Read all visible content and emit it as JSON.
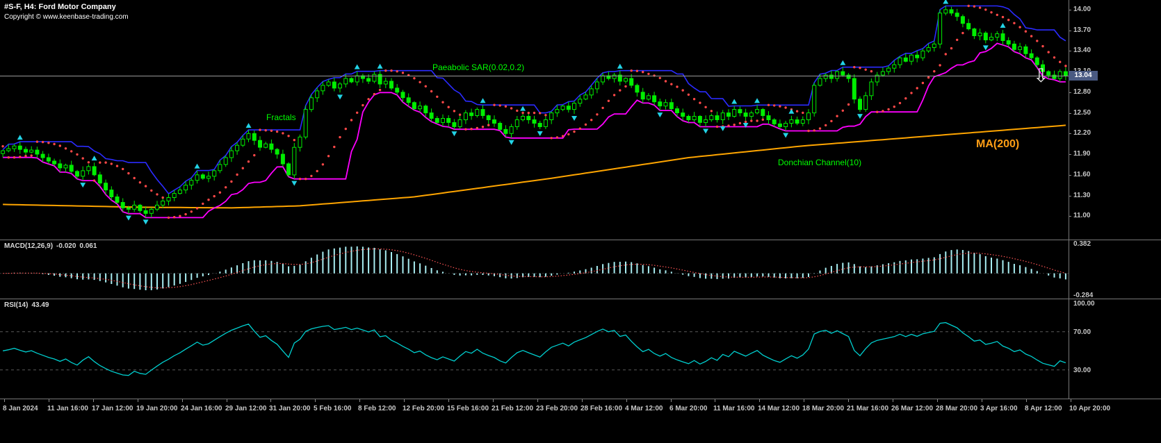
{
  "window": {
    "symbol_info": "#S-F, H4:  Ford Motor Company",
    "copyright": "Copyright © www.keenbase-trading.com"
  },
  "overlays": {
    "psar_label": "Paeabolic SAR(0.02,0.2)",
    "fractals_label": "Fractals",
    "donchian_label": "Donchian Channel(10)",
    "ma_label": "MA(200)"
  },
  "icons": {
    "down_arrow": "⇩"
  },
  "price_axis": {
    "labels": [
      "14.00",
      "13.70",
      "13.40",
      "13.10",
      "12.80",
      "12.50",
      "12.20",
      "11.90",
      "11.60",
      "11.30",
      "11.00"
    ],
    "current_price": "13.04"
  },
  "macd_panel": {
    "label": "MACD(12,26,9)",
    "value_main": "-0.020",
    "value_signal": "0.061",
    "axis_labels": [
      "0.382",
      "-0.284"
    ]
  },
  "rsi_panel": {
    "label": "RSI(14)",
    "value": "43.49",
    "axis_labels": [
      "100.00",
      "70.00",
      "30.00"
    ],
    "levels": [
      70,
      30
    ]
  },
  "time_axis": [
    "8 Jan 2024",
    "11 Jan 16:00",
    "17 Jan 12:00",
    "19 Jan 20:00",
    "24 Jan 16:00",
    "29 Jan 12:00",
    "31 Jan 20:00",
    "5 Feb 16:00",
    "8 Feb 12:00",
    "12 Feb 20:00",
    "15 Feb 16:00",
    "21 Feb 12:00",
    "23 Feb 20:00",
    "28 Feb 16:00",
    "4 Mar 12:00",
    "6 Mar 20:00",
    "11 Mar 16:00",
    "14 Mar 12:00",
    "18 Mar 20:00",
    "21 Mar 16:00",
    "26 Mar 12:00",
    "28 Mar 20:00",
    "3 Apr 16:00",
    "8 Apr 12:00",
    "10 Apr 20:00"
  ],
  "colors": {
    "background": "#000000",
    "candle": "#00ee00",
    "donchian_upper": "#2b2bff",
    "donchian_lower": "#ff00ff",
    "psar": "#ff4848",
    "ma200": "#ffa500",
    "fractal": "#22d3e6",
    "macd_hist": "#a9eef2",
    "macd_signal": "#ff5555",
    "rsi_line": "#00cfcf",
    "axis_text": "#c6c6c6",
    "label_green": "#00ff00",
    "label_orange": "#ff9e15",
    "price_tag_bg": "#4a5a82",
    "separator": "#787878"
  },
  "chart_data": {
    "type": "candlestick",
    "symbol": "#S-F",
    "timeframe": "H4",
    "company": "Ford Motor Company",
    "title": "#S-F, H4: Ford Motor Company",
    "ylim": [
      10.66,
      14.14
    ],
    "macd_ylim": [
      -0.32,
      0.42
    ],
    "rsi_ylim": [
      0,
      104
    ],
    "indicators": [
      "Parabolic SAR(0.02,0.2)",
      "Fractals",
      "Donchian Channel(10)",
      "MA(200)",
      "MACD(12,26,9) last -0.020 / 0.061",
      "RSI(14) last 43.49"
    ],
    "closes": [
      11.95,
      11.98,
      12.02,
      11.97,
      11.93,
      11.96,
      11.9,
      11.85,
      11.8,
      11.76,
      11.7,
      11.74,
      11.65,
      11.58,
      11.66,
      11.72,
      11.6,
      11.48,
      11.38,
      11.28,
      11.2,
      11.12,
      11.1,
      11.16,
      11.08,
      11.04,
      11.1,
      11.16,
      11.22,
      11.27,
      11.33,
      11.38,
      11.45,
      11.52,
      11.6,
      11.55,
      11.58,
      11.66,
      11.75,
      11.85,
      11.95,
      12.03,
      12.12,
      12.2,
      12.1,
      12.0,
      12.05,
      11.97,
      11.9,
      11.76,
      11.6,
      12.0,
      12.15,
      12.55,
      12.72,
      12.82,
      12.9,
      12.95,
      12.86,
      12.92,
      13.0,
      12.95,
      13.04,
      13.0,
      12.96,
      13.06,
      12.92,
      12.96,
      12.86,
      12.8,
      12.72,
      12.65,
      12.56,
      12.6,
      12.5,
      12.42,
      12.36,
      12.42,
      12.36,
      12.3,
      12.4,
      12.5,
      12.46,
      12.55,
      12.46,
      12.4,
      12.35,
      12.26,
      12.2,
      12.3,
      12.4,
      12.45,
      12.4,
      12.35,
      12.3,
      12.4,
      12.5,
      12.55,
      12.6,
      12.55,
      12.64,
      12.7,
      12.76,
      12.85,
      12.95,
      13.04,
      13.0,
      13.05,
      12.96,
      13.0,
      12.9,
      12.8,
      12.7,
      12.75,
      12.66,
      12.6,
      12.65,
      12.56,
      12.5,
      12.45,
      12.4,
      12.45,
      12.36,
      12.4,
      12.46,
      12.4,
      12.5,
      12.45,
      12.55,
      12.5,
      12.45,
      12.5,
      12.55,
      12.46,
      12.4,
      12.34,
      12.3,
      12.35,
      12.4,
      12.35,
      12.4,
      12.5,
      12.9,
      13.0,
      13.05,
      13.0,
      13.1,
      13.05,
      13.0,
      12.7,
      12.55,
      12.75,
      12.95,
      13.05,
      13.1,
      13.15,
      13.2,
      13.3,
      13.25,
      13.34,
      13.3,
      13.4,
      13.45,
      13.5,
      13.95,
      14.0,
      13.95,
      13.9,
      13.8,
      13.72,
      13.62,
      13.66,
      13.56,
      13.6,
      13.65,
      13.55,
      13.5,
      13.42,
      13.46,
      13.36,
      13.3,
      13.2,
      13.1,
      13.05,
      13.0,
      13.1,
      13.04
    ],
    "ma200_anchors": [
      [
        0,
        11.17
      ],
      [
        24,
        11.13
      ],
      [
        40,
        11.12
      ],
      [
        52,
        11.15
      ],
      [
        72,
        11.28
      ],
      [
        96,
        11.55
      ],
      [
        120,
        11.85
      ],
      [
        140,
        12.02
      ],
      [
        160,
        12.15
      ],
      [
        186,
        12.32
      ]
    ]
  }
}
